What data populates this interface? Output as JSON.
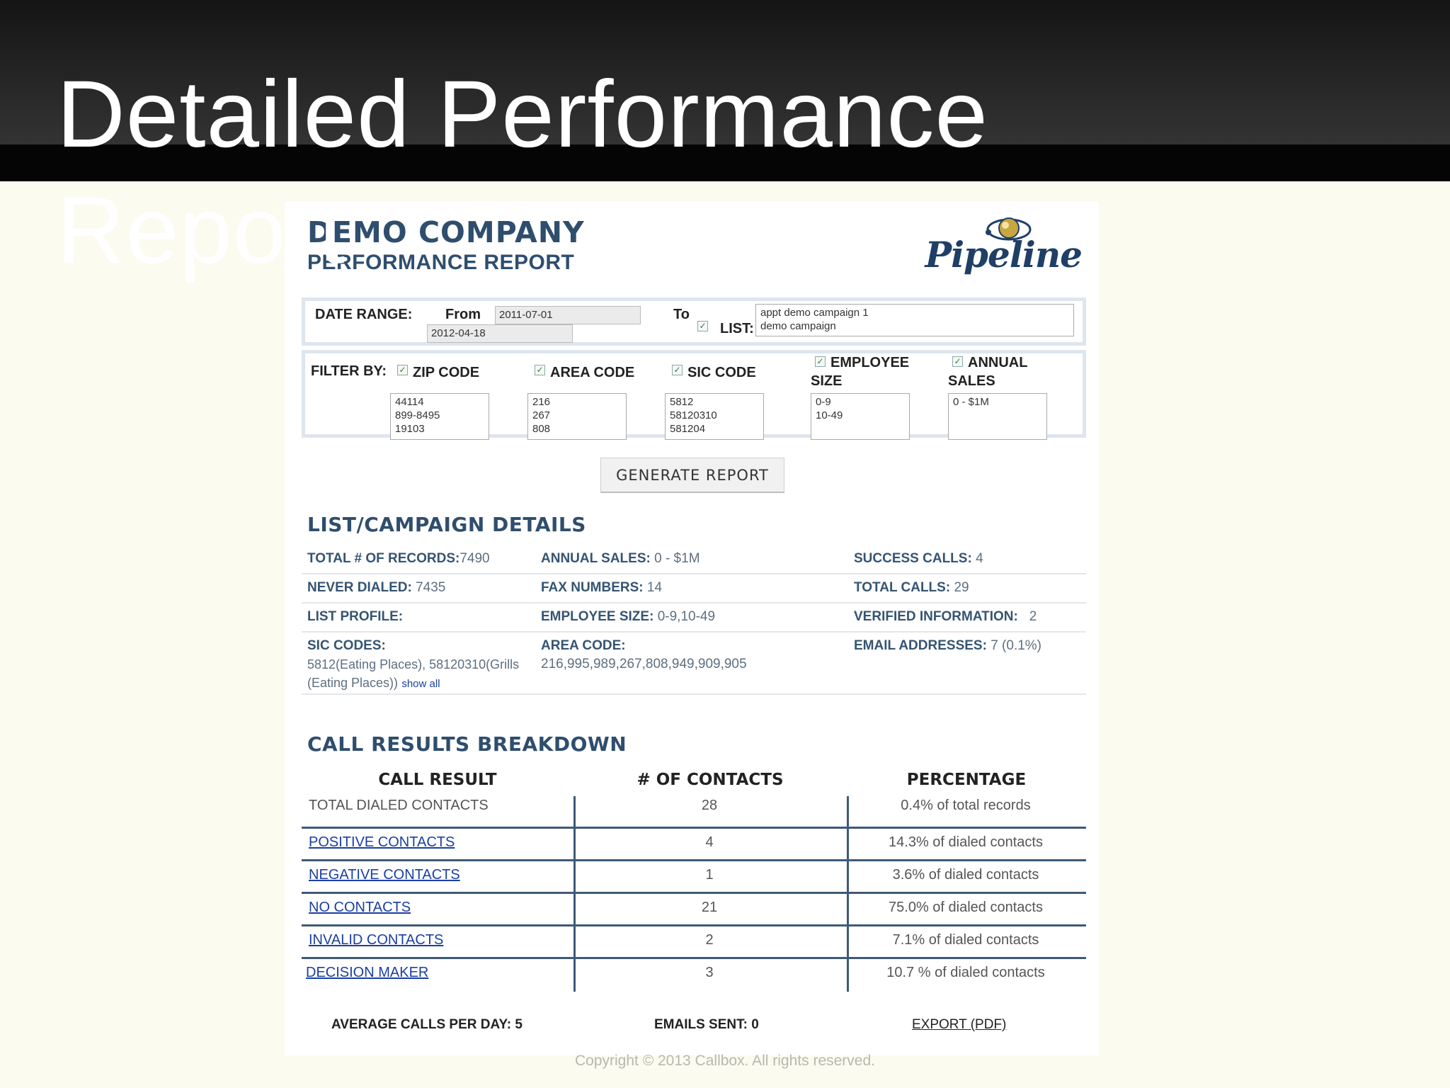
{
  "slide": {
    "title": "Detailed Performance Report",
    "copyright": "Copyright © 2013 Callbox.  All rights reserved."
  },
  "report": {
    "title": "DEMO COMPANY",
    "subtitle": "PERFORMANCE REPORT",
    "brand": "Pipeline"
  },
  "date_range": {
    "label": "DATE RANGE:",
    "from_label": "From",
    "from_value": "2011-07-01",
    "to_label": "To",
    "to_value": "2012-04-18",
    "list_label": "LIST:",
    "list_items": [
      "appt demo campaign 1",
      "demo campaign"
    ]
  },
  "filter": {
    "label": "FILTER BY:",
    "columns": [
      {
        "label": "ZIP CODE",
        "values": [
          "44114",
          "899-8495",
          "19103"
        ]
      },
      {
        "label": "AREA CODE",
        "values": [
          "216",
          "267",
          "808"
        ]
      },
      {
        "label": "SIC CODE",
        "values": [
          "5812",
          "58120310",
          "581204"
        ]
      },
      {
        "label_line1": "EMPLOYEE",
        "label_line2": "SIZE",
        "values": [
          "0-9",
          "10-49"
        ]
      },
      {
        "label_line1": "ANNUAL",
        "label_line2": "SALES",
        "values": [
          "0 - $1M"
        ]
      }
    ]
  },
  "generate_button": "GENERATE REPORT",
  "details": {
    "title": "LIST/CAMPAIGN DETAILS",
    "total_records_label": "TOTAL # OF RECORDS:",
    "total_records_value": "7490",
    "annual_sales_label": "ANNUAL SALES:",
    "annual_sales_value": "0 - $1M",
    "success_calls_label": "SUCCESS CALLS:",
    "success_calls_value": "4",
    "never_dialed_label": "NEVER DIALED:",
    "never_dialed_value": "7435",
    "fax_numbers_label": "FAX NUMBERS:",
    "fax_numbers_value": "14",
    "total_calls_label": "TOTAL CALLS:",
    "total_calls_value": "29",
    "list_profile_label": "LIST PROFILE:",
    "employee_size_label": "EMPLOYEE SIZE:",
    "employee_size_value": "0-9,10-49",
    "verified_label": "VERIFIED INFORMATION:",
    "verified_value": "2",
    "sic_codes_label": "SIC CODES:",
    "sic_codes_value_line1": "5812(Eating Places), 58120310(Grills",
    "sic_codes_value_line2": "(Eating Places))",
    "show_all": "show all",
    "area_code_label": "AREA CODE:",
    "area_code_value": "216,995,989,267,808,949,909,905",
    "email_label": "EMAIL ADDRESSES:",
    "email_value": "7 (0.1%)"
  },
  "breakdown": {
    "title": "CALL RESULTS BREAKDOWN",
    "headers": [
      "CALL RESULT",
      "# OF CONTACTS",
      "PERCENTAGE"
    ],
    "rows": [
      {
        "result": "TOTAL DIALED CONTACTS",
        "contacts": "28",
        "percentage": "0.4% of total records"
      },
      {
        "result": "POSITIVE CONTACTS",
        "contacts": "4",
        "percentage": "14.3% of dialed contacts"
      },
      {
        "result": "NEGATIVE CONTACTS",
        "contacts": "1",
        "percentage": "3.6% of dialed contacts"
      },
      {
        "result": "NO CONTACTS",
        "contacts": "21",
        "percentage": "75.0% of dialed contacts"
      },
      {
        "result": "INVALID CONTACTS",
        "contacts": "2",
        "percentage": "7.1% of dialed contacts"
      },
      {
        "result": "DECISION MAKER",
        "contacts": "3",
        "percentage": "10.7 % of dialed contacts"
      }
    ]
  },
  "footer": {
    "avg_calls": "AVERAGE CALLS PER DAY: 5",
    "emails_sent": "EMAILS SENT: 0",
    "export": "EXPORT (PDF)"
  },
  "colors": {
    "heading_blue": "#2f4e6e",
    "link_blue": "#1a3fa5",
    "slide_bg": "#fbfbf0",
    "header_dark": "#1b1b1b"
  }
}
